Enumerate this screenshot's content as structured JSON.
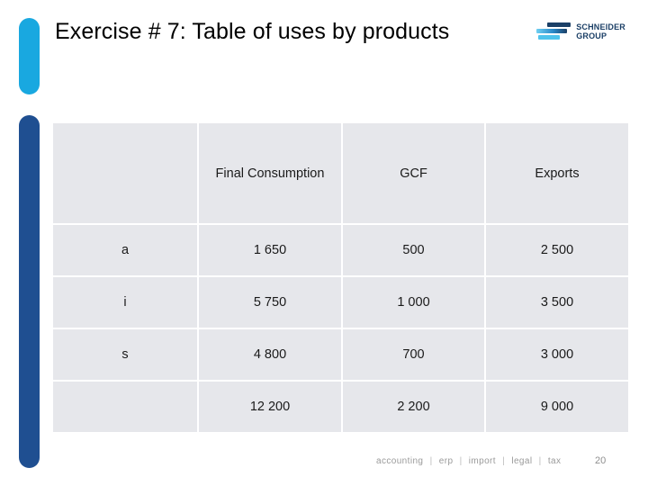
{
  "slide": {
    "title": "Exercise # 7: Table of uses by products",
    "page_number": "20"
  },
  "logo": {
    "name": "SCHNEIDER\nGROUP",
    "mark_color_dark": "#1B3F66",
    "mark_color_light": "#4FC3EC"
  },
  "accents": {
    "top_color": "#19A8E0",
    "bottom_color": "#1F4F91"
  },
  "table": {
    "headers": [
      "",
      "Final\nConsumption",
      "GCF",
      "Exports"
    ],
    "rows": [
      {
        "label": "a",
        "final_consumption": "1 650",
        "gcf": "500",
        "exports": "2 500"
      },
      {
        "label": "i",
        "final_consumption": "5 750",
        "gcf": "1 000",
        "exports": "3 500"
      },
      {
        "label": "s",
        "final_consumption": "4 800",
        "gcf": "700",
        "exports": "3 000"
      },
      {
        "label": "",
        "final_consumption": "12 200",
        "gcf": "2 200",
        "exports": "9 000"
      }
    ],
    "cell_background": "#E6E7EB"
  },
  "footer": {
    "tags": [
      "accounting",
      "erp",
      "import",
      "legal",
      "tax"
    ],
    "separator": "|"
  }
}
